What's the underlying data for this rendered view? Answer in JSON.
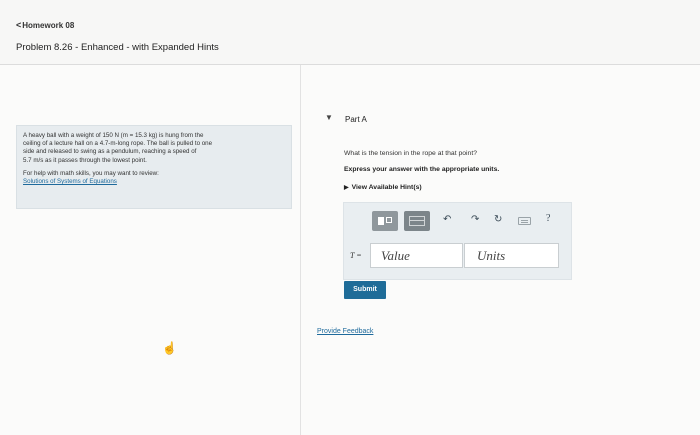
{
  "header": {
    "back_link": "Homework 08",
    "back_chevron": "<",
    "problem_title": "Problem 8.26 - Enhanced - with Expanded Hints"
  },
  "problem": {
    "text_line1": "A heavy ball with a weight of 150 N (m = 15.3 kg) is hung from the",
    "text_line2": "ceiling of a lecture hall on a 4.7-m-long rope. The ball is pulled to one",
    "text_line3": "side and released to swing as a pendulum, reaching a speed of",
    "text_line4": "5.7 m/s as it passes through the lowest point.",
    "help_text": "For help with math skills, you may want to review:",
    "help_link": "Solutions of Systems of Equations"
  },
  "part": {
    "toggle_icon": "▼",
    "label": "Part A",
    "question": "What is the tension in the rope at that point?",
    "instruction": "Express your answer with the appropriate units.",
    "hints_icon": "▶",
    "hints_label": "View Available Hint(s)"
  },
  "toolbar": {
    "icons": [
      "template-icon",
      "units-template-icon",
      "undo-icon",
      "redo-icon",
      "reset-icon",
      "keyboard-icon",
      "help-icon"
    ],
    "undo": "↶",
    "redo": "↷",
    "reset": "↻",
    "help": "?"
  },
  "answer": {
    "variable": "T =",
    "value_placeholder": "Value",
    "units_placeholder": "Units"
  },
  "actions": {
    "submit": "Submit",
    "feedback": "Provide Feedback"
  },
  "colors": {
    "accent": "#1f6c98",
    "link": "#1e6a9c",
    "problem_bg": "#e7ecef"
  }
}
